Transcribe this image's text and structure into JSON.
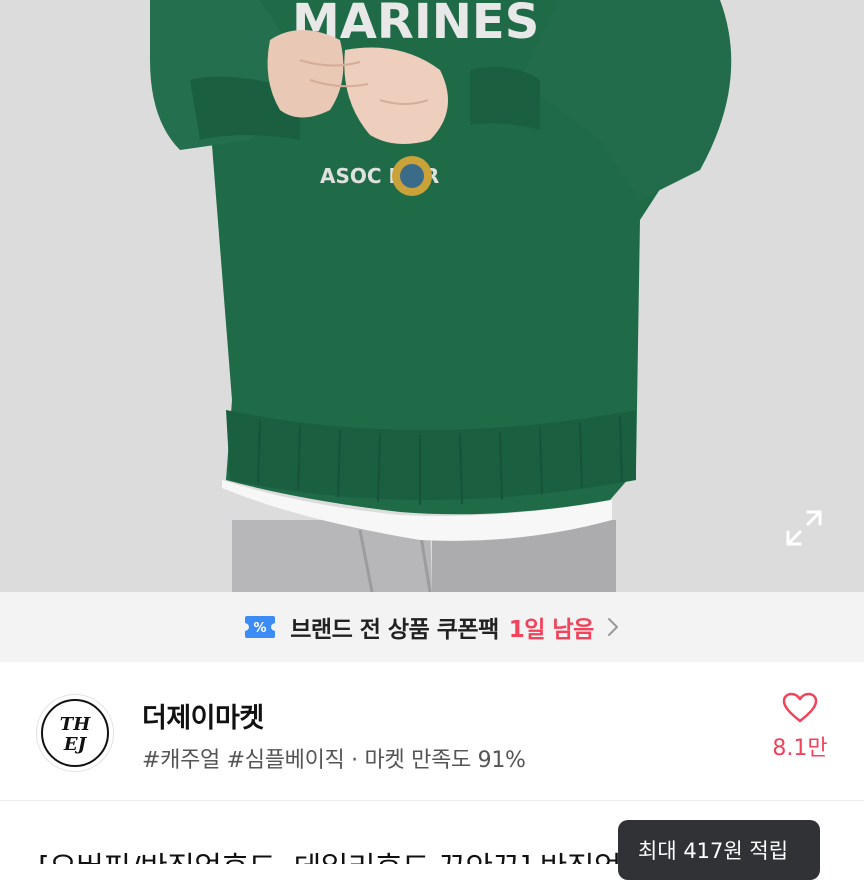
{
  "hero": {
    "image_alt": "product photo",
    "sweatshirt_print_top": "MARINES",
    "sweatshirt_print_mid": "ASOC MAR",
    "colors": {
      "background": "#dcdcdd",
      "sweatshirt": "#1f6b48",
      "pants": "#b5b5b7"
    },
    "expand_icon": "expand-icon"
  },
  "coupon": {
    "icon": "coupon-icon",
    "text": "브랜드 전 상품 쿠폰팩",
    "time_left": "1일 남음",
    "chevron": "chevron-right-icon",
    "accent_color": "#f2435a"
  },
  "shop": {
    "logo_line1": "TH",
    "logo_line2": "EJ",
    "name": "더제이마켓",
    "meta": "#캐주얼 #심플베이직 · 마켓 만족도 91%",
    "like_icon": "heart-icon",
    "like_count": "8.1만"
  },
  "product": {
    "title": "[오버핏/반집업후드, 데일리후드 꾸안꾸] 반집업 후드티"
  },
  "reward_tooltip": {
    "text": "최대 417원 적립"
  }
}
